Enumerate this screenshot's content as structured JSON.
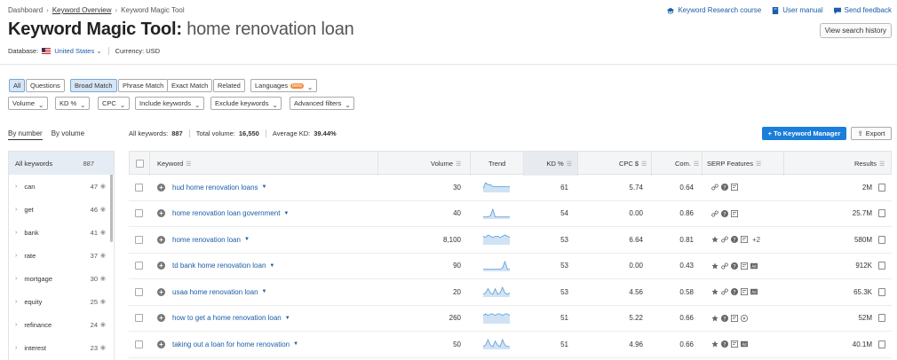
{
  "breadcrumbs": [
    "Dashboard",
    "Keyword Overview",
    "Keyword Magic Tool"
  ],
  "top_links": {
    "course": "Keyword Research course",
    "manual": "User manual",
    "feedback": "Send feedback"
  },
  "title": {
    "tool": "Keyword Magic Tool:",
    "query": "home renovation loan"
  },
  "history_button": "View search history",
  "database": {
    "label": "Database:",
    "value": "United States",
    "currency": "Currency: USD"
  },
  "filters_row1": [
    "All",
    "Questions",
    "Broad Match",
    "Phrase Match",
    "Exact Match",
    "Related",
    "Languages"
  ],
  "beta_label": "beta",
  "filters_row2": [
    "Volume",
    "KD %",
    "CPC",
    "Include keywords",
    "Exclude keywords",
    "Advanced filters"
  ],
  "view_tabs": {
    "by_number": "By number",
    "by_volume": "By volume"
  },
  "stats": {
    "all_label": "All keywords:",
    "all_value": "887",
    "vol_label": "Total volume:",
    "vol_value": "16,550",
    "kd_label": "Average KD:",
    "kd_value": "39.44%"
  },
  "actions": {
    "manager": "+ To Keyword Manager",
    "export": "Export"
  },
  "sidebar": [
    {
      "label": "All keywords",
      "count": "887"
    },
    {
      "label": "can",
      "count": "47"
    },
    {
      "label": "get",
      "count": "46"
    },
    {
      "label": "bank",
      "count": "41"
    },
    {
      "label": "rate",
      "count": "37"
    },
    {
      "label": "mortgage",
      "count": "30"
    },
    {
      "label": "equity",
      "count": "25"
    },
    {
      "label": "refinance",
      "count": "24"
    },
    {
      "label": "interest",
      "count": "23"
    }
  ],
  "columns": {
    "keyword": "Keyword",
    "volume": "Volume",
    "trend": "Trend",
    "kd": "KD %",
    "cpc": "CPC $",
    "com": "Com.",
    "serp": "SERP Features",
    "results": "Results"
  },
  "rows": [
    {
      "keyword": "hud home renovation loans",
      "volume": "30",
      "kd": "61",
      "cpc": "5.74",
      "com": "0.64",
      "results": "2M",
      "serp": [
        "link",
        "help",
        "msg"
      ],
      "extra": "",
      "trend": [
        2,
        5,
        4,
        4,
        3,
        3,
        3,
        3,
        3,
        3,
        3,
        3
      ]
    },
    {
      "keyword": "home renovation loan government",
      "volume": "40",
      "kd": "54",
      "cpc": "0.00",
      "com": "0.86",
      "results": "25.7M",
      "serp": [
        "link",
        "help",
        "msg"
      ],
      "extra": "",
      "trend": [
        2,
        2,
        2,
        3,
        9,
        2,
        2,
        2,
        2,
        2,
        2,
        2
      ]
    },
    {
      "keyword": "home renovation loan",
      "volume": "8,100",
      "kd": "53",
      "cpc": "6.64",
      "com": "0.81",
      "results": "580M",
      "serp": [
        "star",
        "link",
        "help",
        "msg"
      ],
      "extra": "+2",
      "trend": [
        7,
        6,
        8,
        7,
        6,
        7,
        7,
        6,
        7,
        8,
        7,
        6
      ]
    },
    {
      "keyword": "td bank home renovation loan",
      "volume": "90",
      "kd": "53",
      "cpc": "0.00",
      "com": "0.43",
      "results": "912K",
      "serp": [
        "star",
        "link",
        "help",
        "msg",
        "ad"
      ],
      "extra": "",
      "trend": [
        2,
        2,
        2,
        2,
        2,
        2,
        2,
        2,
        3,
        9,
        2,
        2
      ]
    },
    {
      "keyword": "usaa home renovation loan",
      "volume": "20",
      "kd": "53",
      "cpc": "4.56",
      "com": "0.58",
      "results": "65.3K",
      "serp": [
        "star",
        "link",
        "help",
        "msg",
        "ad"
      ],
      "extra": "",
      "trend": [
        2,
        3,
        6,
        3,
        2,
        6,
        2,
        3,
        7,
        3,
        2,
        3
      ]
    },
    {
      "keyword": "how to get a home renovation loan",
      "volume": "260",
      "kd": "51",
      "cpc": "5.22",
      "com": "0.66",
      "results": "52M",
      "serp": [
        "star",
        "help",
        "msg",
        "play"
      ],
      "extra": "",
      "trend": [
        5,
        6,
        5,
        6,
        6,
        5,
        6,
        6,
        5,
        6,
        6,
        5
      ]
    },
    {
      "keyword": "taking out a loan for home renovation",
      "volume": "50",
      "kd": "51",
      "cpc": "4.96",
      "com": "0.66",
      "results": "40.1M",
      "serp": [
        "star",
        "help",
        "msg",
        "ad"
      ],
      "extra": "",
      "trend": [
        2,
        3,
        7,
        3,
        2,
        6,
        3,
        2,
        7,
        3,
        2,
        2
      ]
    }
  ]
}
